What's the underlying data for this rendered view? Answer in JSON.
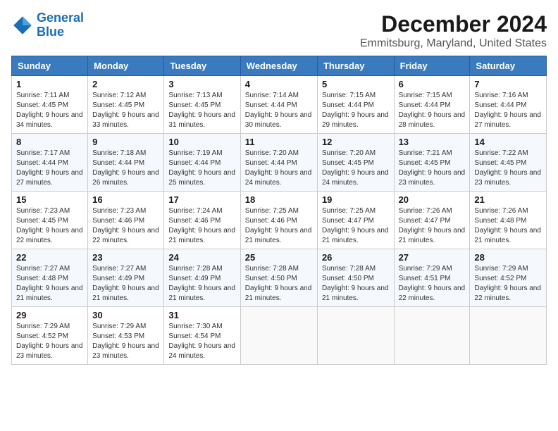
{
  "logo": {
    "line1": "General",
    "line2": "Blue"
  },
  "title": "December 2024",
  "subtitle": "Emmitsburg, Maryland, United States",
  "days_of_week": [
    "Sunday",
    "Monday",
    "Tuesday",
    "Wednesday",
    "Thursday",
    "Friday",
    "Saturday"
  ],
  "weeks": [
    [
      {
        "day": "1",
        "sunrise": "7:11 AM",
        "sunset": "4:45 PM",
        "daylight": "9 hours and 34 minutes."
      },
      {
        "day": "2",
        "sunrise": "7:12 AM",
        "sunset": "4:45 PM",
        "daylight": "9 hours and 33 minutes."
      },
      {
        "day": "3",
        "sunrise": "7:13 AM",
        "sunset": "4:45 PM",
        "daylight": "9 hours and 31 minutes."
      },
      {
        "day": "4",
        "sunrise": "7:14 AM",
        "sunset": "4:44 PM",
        "daylight": "9 hours and 30 minutes."
      },
      {
        "day": "5",
        "sunrise": "7:15 AM",
        "sunset": "4:44 PM",
        "daylight": "9 hours and 29 minutes."
      },
      {
        "day": "6",
        "sunrise": "7:15 AM",
        "sunset": "4:44 PM",
        "daylight": "9 hours and 28 minutes."
      },
      {
        "day": "7",
        "sunrise": "7:16 AM",
        "sunset": "4:44 PM",
        "daylight": "9 hours and 27 minutes."
      }
    ],
    [
      {
        "day": "8",
        "sunrise": "7:17 AM",
        "sunset": "4:44 PM",
        "daylight": "9 hours and 27 minutes."
      },
      {
        "day": "9",
        "sunrise": "7:18 AM",
        "sunset": "4:44 PM",
        "daylight": "9 hours and 26 minutes."
      },
      {
        "day": "10",
        "sunrise": "7:19 AM",
        "sunset": "4:44 PM",
        "daylight": "9 hours and 25 minutes."
      },
      {
        "day": "11",
        "sunrise": "7:20 AM",
        "sunset": "4:44 PM",
        "daylight": "9 hours and 24 minutes."
      },
      {
        "day": "12",
        "sunrise": "7:20 AM",
        "sunset": "4:45 PM",
        "daylight": "9 hours and 24 minutes."
      },
      {
        "day": "13",
        "sunrise": "7:21 AM",
        "sunset": "4:45 PM",
        "daylight": "9 hours and 23 minutes."
      },
      {
        "day": "14",
        "sunrise": "7:22 AM",
        "sunset": "4:45 PM",
        "daylight": "9 hours and 23 minutes."
      }
    ],
    [
      {
        "day": "15",
        "sunrise": "7:23 AM",
        "sunset": "4:45 PM",
        "daylight": "9 hours and 22 minutes."
      },
      {
        "day": "16",
        "sunrise": "7:23 AM",
        "sunset": "4:46 PM",
        "daylight": "9 hours and 22 minutes."
      },
      {
        "day": "17",
        "sunrise": "7:24 AM",
        "sunset": "4:46 PM",
        "daylight": "9 hours and 21 minutes."
      },
      {
        "day": "18",
        "sunrise": "7:25 AM",
        "sunset": "4:46 PM",
        "daylight": "9 hours and 21 minutes."
      },
      {
        "day": "19",
        "sunrise": "7:25 AM",
        "sunset": "4:47 PM",
        "daylight": "9 hours and 21 minutes."
      },
      {
        "day": "20",
        "sunrise": "7:26 AM",
        "sunset": "4:47 PM",
        "daylight": "9 hours and 21 minutes."
      },
      {
        "day": "21",
        "sunrise": "7:26 AM",
        "sunset": "4:48 PM",
        "daylight": "9 hours and 21 minutes."
      }
    ],
    [
      {
        "day": "22",
        "sunrise": "7:27 AM",
        "sunset": "4:48 PM",
        "daylight": "9 hours and 21 minutes."
      },
      {
        "day": "23",
        "sunrise": "7:27 AM",
        "sunset": "4:49 PM",
        "daylight": "9 hours and 21 minutes."
      },
      {
        "day": "24",
        "sunrise": "7:28 AM",
        "sunset": "4:49 PM",
        "daylight": "9 hours and 21 minutes."
      },
      {
        "day": "25",
        "sunrise": "7:28 AM",
        "sunset": "4:50 PM",
        "daylight": "9 hours and 21 minutes."
      },
      {
        "day": "26",
        "sunrise": "7:28 AM",
        "sunset": "4:50 PM",
        "daylight": "9 hours and 21 minutes."
      },
      {
        "day": "27",
        "sunrise": "7:29 AM",
        "sunset": "4:51 PM",
        "daylight": "9 hours and 22 minutes."
      },
      {
        "day": "28",
        "sunrise": "7:29 AM",
        "sunset": "4:52 PM",
        "daylight": "9 hours and 22 minutes."
      }
    ],
    [
      {
        "day": "29",
        "sunrise": "7:29 AM",
        "sunset": "4:52 PM",
        "daylight": "9 hours and 23 minutes."
      },
      {
        "day": "30",
        "sunrise": "7:29 AM",
        "sunset": "4:53 PM",
        "daylight": "9 hours and 23 minutes."
      },
      {
        "day": "31",
        "sunrise": "7:30 AM",
        "sunset": "4:54 PM",
        "daylight": "9 hours and 24 minutes."
      },
      null,
      null,
      null,
      null
    ]
  ]
}
